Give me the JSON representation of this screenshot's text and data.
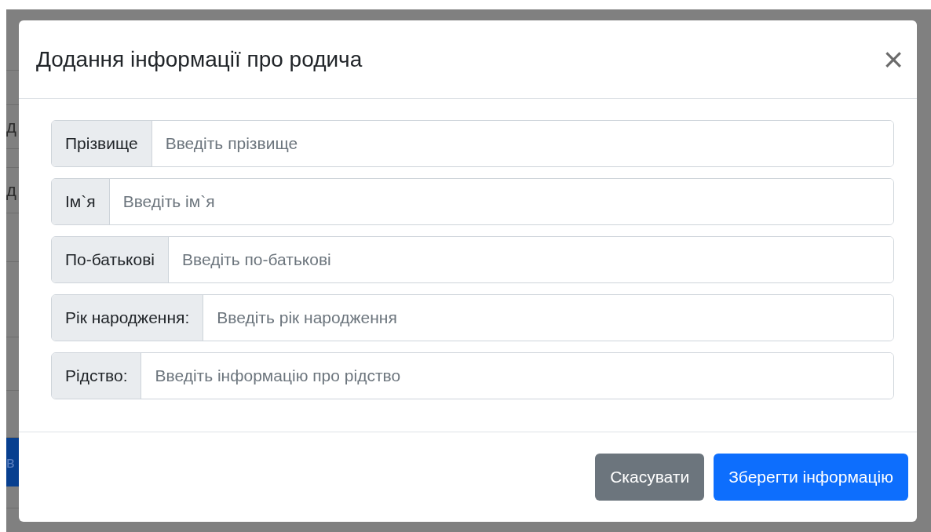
{
  "background": {
    "row_fragments": [
      "д",
      "д"
    ],
    "button_fragment": "в"
  },
  "modal": {
    "title": "Додання інформації про родича",
    "close": "×",
    "fields": [
      {
        "label": "Прізвище",
        "placeholder": "Введіть прізвище"
      },
      {
        "label": "Ім`я",
        "placeholder": "Введіть ім`я"
      },
      {
        "label": "По-батькові",
        "placeholder": "Введіть по-батькові"
      },
      {
        "label": "Рік народження:",
        "placeholder": "Введіть рік народження"
      },
      {
        "label": "Рідство:",
        "placeholder": "Введіть інформацію про рідство"
      }
    ],
    "buttons": [
      {
        "label": "Скасувати",
        "kind": "secondary"
      },
      {
        "label": "Зберегти інформацію",
        "kind": "primary"
      }
    ]
  }
}
